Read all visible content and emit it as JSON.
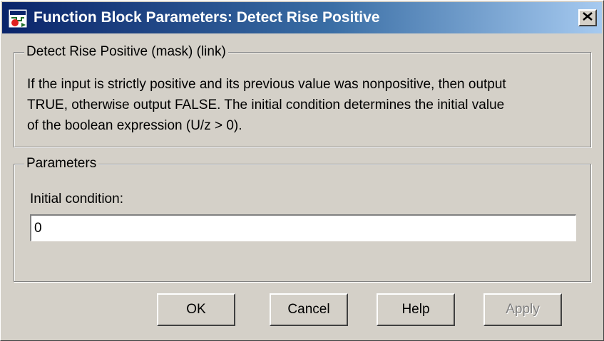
{
  "window": {
    "title": "Function Block Parameters: Detect Rise Positive",
    "app_icon": "simulink-block-icon",
    "close_icon": "close-x-icon"
  },
  "description_group": {
    "legend": "Detect Rise Positive (mask) (link)",
    "lines": [
      "If the input is strictly positive and its previous value was nonpositive, then output",
      "TRUE, otherwise output FALSE.  The initial condition determines the initial value",
      "of the boolean expression (U/z > 0)."
    ]
  },
  "parameters_group": {
    "legend": "Parameters",
    "initial_condition": {
      "label": "Initial condition:",
      "value": "0"
    }
  },
  "buttons": {
    "ok": "OK",
    "cancel": "Cancel",
    "help": "Help",
    "apply": "Apply"
  },
  "colors": {
    "title_gradient_start": "#0a246a",
    "title_gradient_end": "#a6caf0",
    "dialog_background": "#d4d0c8"
  }
}
